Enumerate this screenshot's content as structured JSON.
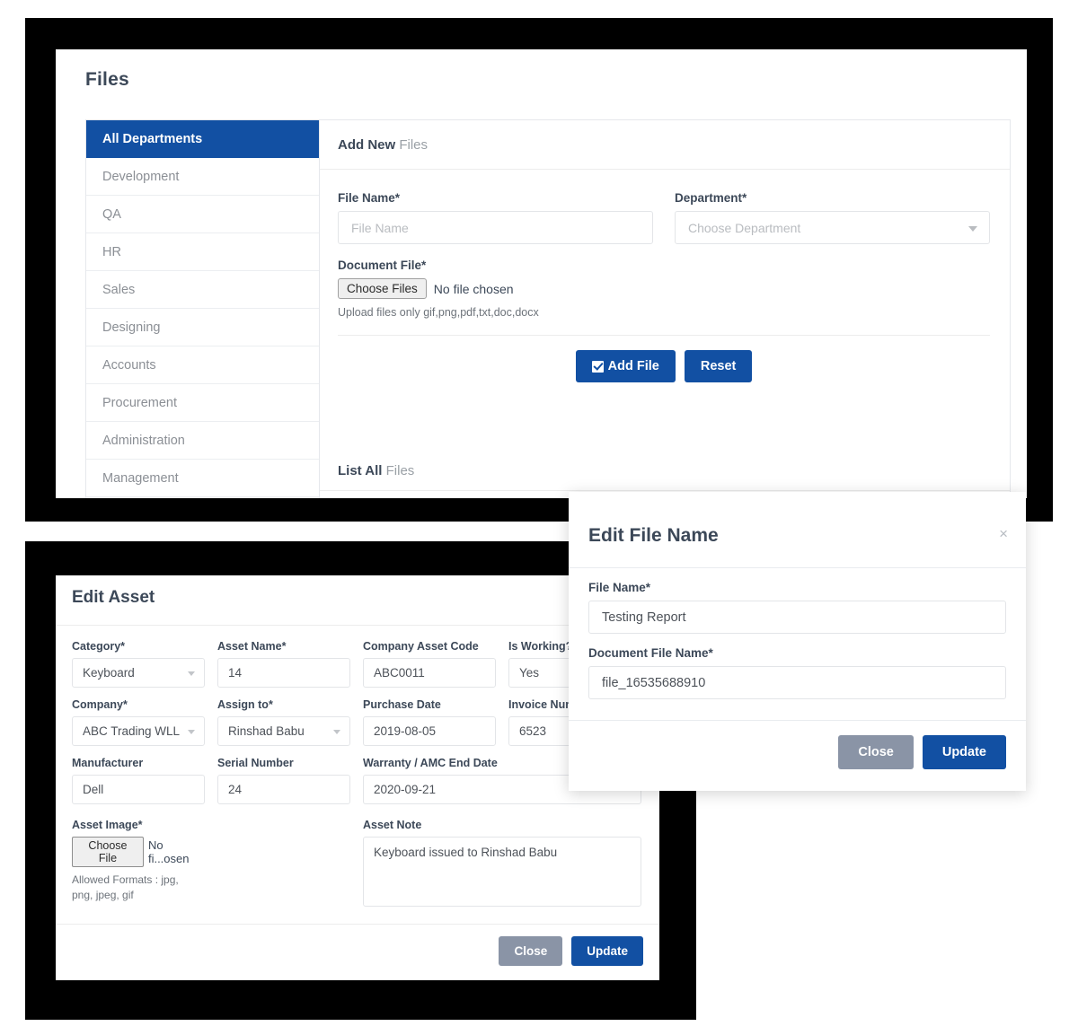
{
  "colors": {
    "accent": "#1250a3",
    "grey_button": "#8a94a6",
    "backdrop": "#000000"
  },
  "files_page": {
    "title": "Files",
    "departments": [
      {
        "label": "All Departments",
        "active": true
      },
      {
        "label": "Development",
        "active": false
      },
      {
        "label": "QA",
        "active": false
      },
      {
        "label": "HR",
        "active": false
      },
      {
        "label": "Sales",
        "active": false
      },
      {
        "label": "Designing",
        "active": false
      },
      {
        "label": "Accounts",
        "active": false
      },
      {
        "label": "Procurement",
        "active": false
      },
      {
        "label": "Administration",
        "active": false
      },
      {
        "label": "Management",
        "active": false
      }
    ],
    "add_new": {
      "heading_bold": "Add New",
      "heading_rest": " Files",
      "file_name_label": "File Name*",
      "file_name_placeholder": "File Name",
      "file_name_value": "",
      "department_label": "Department*",
      "department_placeholder": "Choose Department",
      "document_file_label": "Document File*",
      "choose_files_button": "Choose Files",
      "no_file_chosen": "No file chosen",
      "upload_hint": "Upload files only gif,png,pdf,txt,doc,docx",
      "add_file_button": "Add File",
      "reset_button": "Reset"
    },
    "list_all": {
      "heading_bold": "List All",
      "heading_rest": " Files"
    }
  },
  "edit_asset": {
    "title": "Edit Asset",
    "fields": {
      "category_label": "Category*",
      "category_value": "Keyboard",
      "asset_name_label": "Asset Name*",
      "asset_name_value": "14",
      "company_asset_code_label": "Company Asset Code",
      "company_asset_code_value": "ABC0011",
      "is_working_label": "Is Working?",
      "is_working_value": "Yes",
      "company_label": "Company*",
      "company_value": "ABC Trading WLL",
      "assign_to_label": "Assign to*",
      "assign_to_value": "Rinshad Babu",
      "purchase_date_label": "Purchase Date",
      "purchase_date_value": "2019-08-05",
      "invoice_number_label": "Invoice Number",
      "invoice_number_value": "6523",
      "manufacturer_label": "Manufacturer",
      "manufacturer_value": "Dell",
      "serial_number_label": "Serial Number",
      "serial_number_value": "24",
      "warranty_label": "Warranty / AMC End Date",
      "warranty_value": "2020-09-21",
      "asset_image_label": "Asset Image*",
      "choose_file_button": "Choose File",
      "no_file_chosen": "No fi...osen",
      "allowed_formats_hint": "Allowed Formats : jpg, png, jpeg, gif",
      "asset_note_label": "Asset Note",
      "asset_note_value": "Keyboard issued to Rinshad Babu"
    },
    "close_button": "Close",
    "update_button": "Update"
  },
  "edit_file_modal": {
    "title": "Edit File Name",
    "close_icon": "×",
    "file_name_label": "File Name*",
    "file_name_value": "Testing Report",
    "document_file_name_label": "Document File Name*",
    "document_file_name_value": "file_16535688910",
    "close_button": "Close",
    "update_button": "Update"
  }
}
